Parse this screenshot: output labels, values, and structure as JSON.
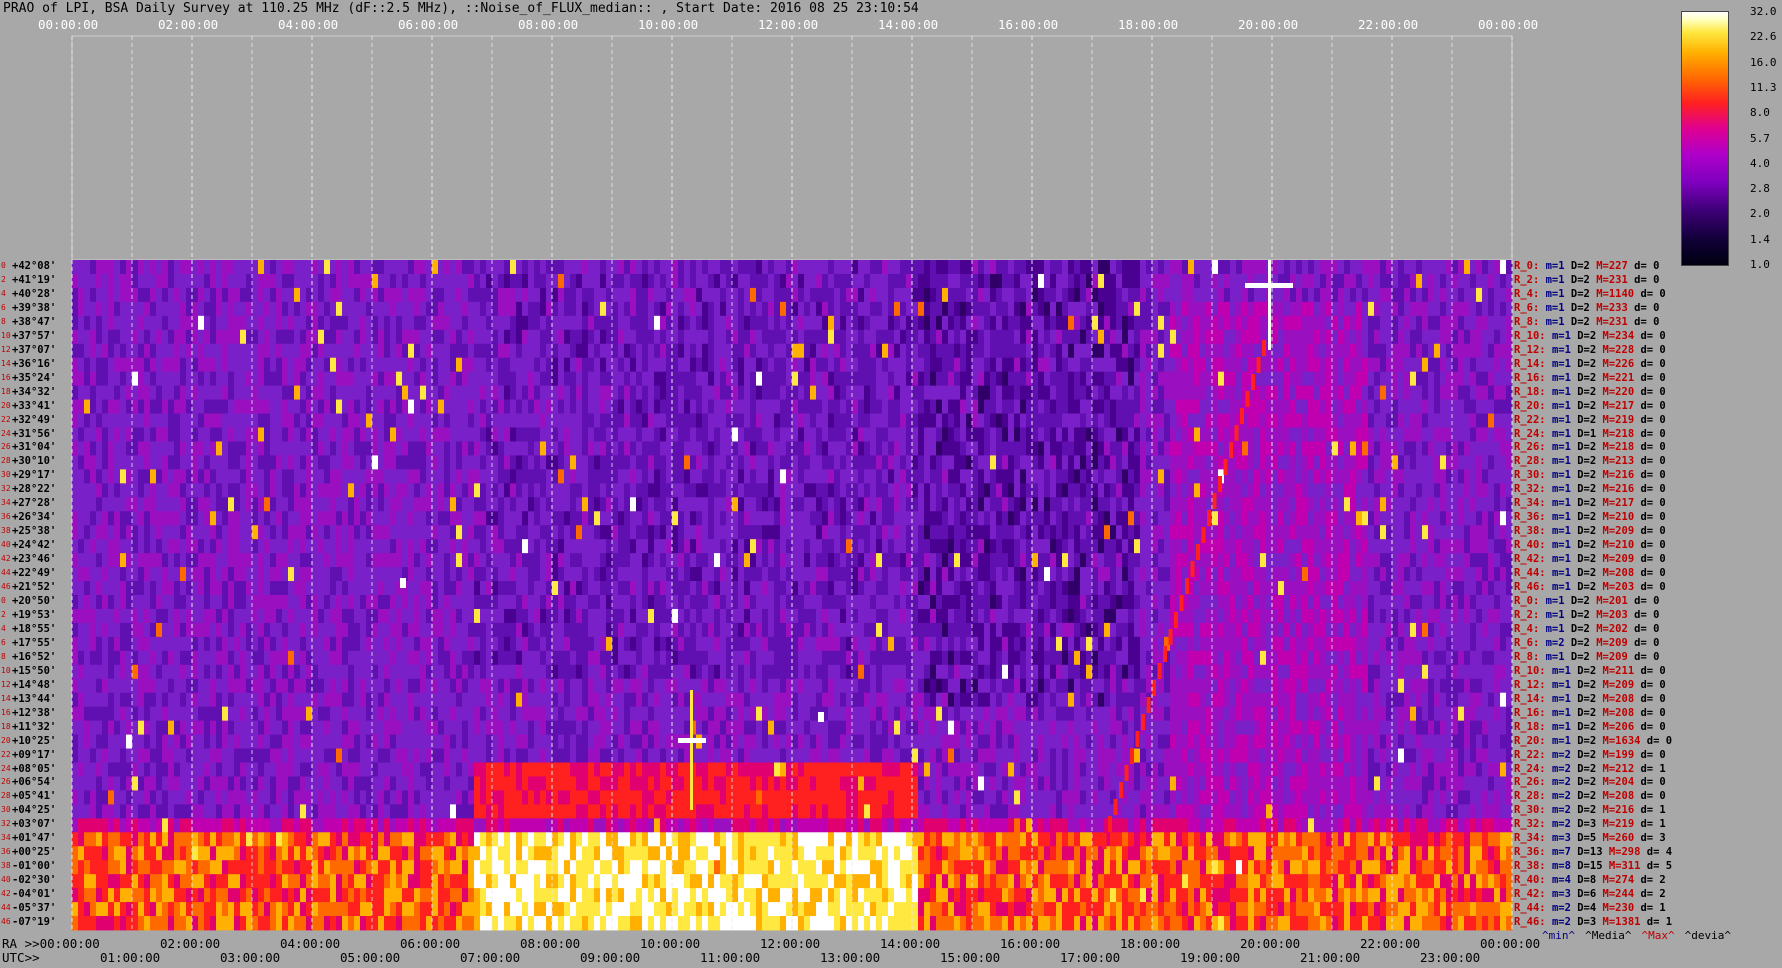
{
  "title": "PRAO of LPI, BSA Daily Survey at 110.25 MHz (dF::2.5 MHz), ::Noise_of_FLUX_median:: , Start Date: 2016 08 25 23:10:54",
  "chart_data": {
    "type": "heatmap",
    "x_axis_top": [
      "00:00:00",
      "02:00:00",
      "04:00:00",
      "06:00:00",
      "08:00:00",
      "10:00:00",
      "12:00:00",
      "14:00:00",
      "16:00:00",
      "18:00:00",
      "20:00:00",
      "22:00:00",
      "00:00:00"
    ],
    "x_axis_ra": [
      "RA >>00:00:00",
      "02:00:00",
      "04:00:00",
      "06:00:00",
      "08:00:00",
      "10:00:00",
      "12:00:00",
      "14:00:00",
      "16:00:00",
      "18:00:00",
      "20:00:00",
      "22:00:00",
      "00:00:00"
    ],
    "x_axis_utc": [
      "UTC>>",
      "01:00:00",
      "03:00:00",
      "05:00:00",
      "07:00:00",
      "09:00:00",
      "11:00:00",
      "13:00:00",
      "15:00:00",
      "17:00:00",
      "19:00:00",
      "21:00:00",
      "23:00:00"
    ],
    "declinations": [
      "+42°08'",
      "+41°19'",
      "+40°28'",
      "+39°38'",
      "+38°47'",
      "+37°57'",
      "+37°07'",
      "+36°16'",
      "+35°24'",
      "+34°32'",
      "+33°41'",
      "+32°49'",
      "+31°56'",
      "+31°04'",
      "+30°10'",
      "+29°17'",
      "+28°22'",
      "+27°28'",
      "+26°34'",
      "+25°38'",
      "+24°42'",
      "+23°46'",
      "+22°49'",
      "+21°52'",
      "+20°50'",
      "+19°53'",
      "+18°55'",
      "+17°55'",
      "+16°52'",
      "+15°50'",
      "+14°48'",
      "+13°44'",
      "+12°38'",
      "+11°32'",
      "+10°25'",
      "+09°17'",
      "+08°05'",
      "+06°54'",
      "+05°41'",
      "+04°25'",
      "+03°07'",
      "+01°47'",
      "+00°25'",
      "-01°00'",
      "-02°30'",
      "-04°01'",
      "-05°37'",
      "-07°19'"
    ],
    "row_numbers": [
      "0",
      "2",
      "4",
      "6",
      "8",
      "10",
      "12",
      "14",
      "16",
      "18",
      "20",
      "22",
      "24",
      "26",
      "28",
      "30",
      "32",
      "34",
      "36",
      "38",
      "40",
      "42",
      "44",
      "46",
      "0",
      "2",
      "4",
      "6",
      "8",
      "10",
      "12",
      "14",
      "16",
      "18",
      "20",
      "22",
      "24",
      "26",
      "28",
      "30",
      "32",
      "34",
      "36",
      "38",
      "40",
      "42",
      "44",
      "46"
    ],
    "stats": [
      [
        "R_0:",
        "m=1",
        "D=2",
        "M=227",
        "d= 0"
      ],
      [
        "R_2:",
        "m=1",
        "D=2",
        "M=231",
        "d= 0"
      ],
      [
        "R_4:",
        "m=1",
        "D=2",
        "M=1140",
        "d= 0"
      ],
      [
        "R_6:",
        "m=1",
        "D=2",
        "M=233",
        "d= 0"
      ],
      [
        "R_8:",
        "m=1",
        "D=2",
        "M=231",
        "d= 0"
      ],
      [
        "R_10:",
        "m=1",
        "D=2",
        "M=234",
        "d= 0"
      ],
      [
        "R_12:",
        "m=1",
        "D=2",
        "M=228",
        "d= 0"
      ],
      [
        "R_14:",
        "m=1",
        "D=2",
        "M=226",
        "d= 0"
      ],
      [
        "R_16:",
        "m=1",
        "D=2",
        "M=221",
        "d= 0"
      ],
      [
        "R_18:",
        "m=1",
        "D=2",
        "M=220",
        "d= 0"
      ],
      [
        "R_20:",
        "m=1",
        "D=2",
        "M=217",
        "d= 0"
      ],
      [
        "R_22:",
        "m=1",
        "D=2",
        "M=219",
        "d= 0"
      ],
      [
        "R_24:",
        "m=1",
        "D=1",
        "M=218",
        "d= 0"
      ],
      [
        "R_26:",
        "m=1",
        "D=2",
        "M=218",
        "d= 0"
      ],
      [
        "R_28:",
        "m=1",
        "D=2",
        "M=213",
        "d= 0"
      ],
      [
        "R_30:",
        "m=1",
        "D=2",
        "M=216",
        "d= 0"
      ],
      [
        "R_32:",
        "m=1",
        "D=2",
        "M=216",
        "d= 0"
      ],
      [
        "R_34:",
        "m=1",
        "D=2",
        "M=217",
        "d= 0"
      ],
      [
        "R_36:",
        "m=1",
        "D=2",
        "M=210",
        "d= 0"
      ],
      [
        "R_38:",
        "m=1",
        "D=2",
        "M=209",
        "d= 0"
      ],
      [
        "R_40:",
        "m=1",
        "D=2",
        "M=210",
        "d= 0"
      ],
      [
        "R_42:",
        "m=1",
        "D=2",
        "M=209",
        "d= 0"
      ],
      [
        "R_44:",
        "m=1",
        "D=2",
        "M=208",
        "d= 0"
      ],
      [
        "R_46:",
        "m=1",
        "D=2",
        "M=203",
        "d= 0"
      ],
      [
        "R_0:",
        "m=1",
        "D=2",
        "M=201",
        "d= 0"
      ],
      [
        "R_2:",
        "m=1",
        "D=2",
        "M=203",
        "d= 0"
      ],
      [
        "R_4:",
        "m=1",
        "D=2",
        "M=202",
        "d= 0"
      ],
      [
        "R_6:",
        "m=2",
        "D=2",
        "M=209",
        "d= 0"
      ],
      [
        "R_8:",
        "m=1",
        "D=2",
        "M=209",
        "d= 0"
      ],
      [
        "R_10:",
        "m=1",
        "D=2",
        "M=211",
        "d= 0"
      ],
      [
        "R_12:",
        "m=1",
        "D=2",
        "M=209",
        "d= 0"
      ],
      [
        "R_14:",
        "m=1",
        "D=2",
        "M=208",
        "d= 0"
      ],
      [
        "R_16:",
        "m=1",
        "D=2",
        "M=208",
        "d= 0"
      ],
      [
        "R_18:",
        "m=1",
        "D=2",
        "M=206",
        "d= 0"
      ],
      [
        "R_20:",
        "m=1",
        "D=2",
        "M=1634",
        "d= 0"
      ],
      [
        "R_22:",
        "m=2",
        "D=2",
        "M=199",
        "d= 0"
      ],
      [
        "R_24:",
        "m=2",
        "D=2",
        "M=212",
        "d= 1"
      ],
      [
        "R_26:",
        "m=2",
        "D=2",
        "M=204",
        "d= 0"
      ],
      [
        "R_28:",
        "m=2",
        "D=2",
        "M=208",
        "d= 0"
      ],
      [
        "R_30:",
        "m=2",
        "D=2",
        "M=216",
        "d= 1"
      ],
      [
        "R_32:",
        "m=2",
        "D=3",
        "M=219",
        "d= 1"
      ],
      [
        "R_34:",
        "m=3",
        "D=5",
        "M=260",
        "d= 3"
      ],
      [
        "R_36:",
        "m=7",
        "D=13",
        "M=298",
        "d= 4"
      ],
      [
        "R_38:",
        "m=8",
        "D=15",
        "M=311",
        "d= 5"
      ],
      [
        "R_40:",
        "m=4",
        "D=8",
        "M=274",
        "d= 2"
      ],
      [
        "R_42:",
        "m=3",
        "D=6",
        "M=244",
        "d= 2"
      ],
      [
        "R_44:",
        "m=2",
        "D=4",
        "M=230",
        "d= 1"
      ],
      [
        "R_46:",
        "m=2",
        "D=3",
        "M=1381",
        "d= 1"
      ]
    ],
    "legend": [
      "^min^",
      "^Media^",
      "^Max^",
      "^devia^"
    ],
    "colorbar": [
      "32.0",
      "22.6",
      "16.0",
      "11.3",
      "8.0",
      "5.7",
      "4.0",
      "2.8",
      "2.0",
      "1.4",
      "1.0"
    ],
    "colors": {
      "low": "#000010",
      "mid": "#8000c0",
      "high": "#ff2020",
      "max": "#ffffff"
    }
  }
}
